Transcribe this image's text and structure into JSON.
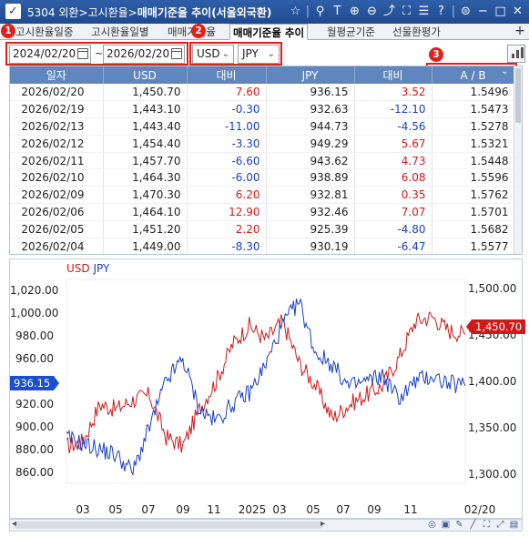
{
  "window": {
    "screen_no": "5304",
    "path": "외환>고시환율>",
    "name": "매매기준율 추이(서울외국환)"
  },
  "tabs": [
    {
      "label": "고시환율일중"
    },
    {
      "label": "고시환율일별"
    },
    {
      "label": "매매기준율"
    },
    {
      "label": "매매기준율 추이"
    },
    {
      "label": "월평균기준"
    },
    {
      "label": "선물환평가"
    }
  ],
  "controls": {
    "start_date": "2024/02/20",
    "range_sep": "~",
    "end_date": "2026/02/20",
    "currency_a": "USD",
    "currency_b": "JPY",
    "badges": [
      "1",
      "2",
      "3"
    ]
  },
  "table": {
    "headers": [
      "일자",
      "USD",
      "대비",
      "JPY",
      "대비",
      "A / B"
    ],
    "rows": [
      {
        "date": "2026/02/20",
        "usd": "1,450.70",
        "usd_chg": "7.60",
        "jpy": "936.15",
        "jpy_chg": "3.52",
        "ab": "1.5496"
      },
      {
        "date": "2026/02/19",
        "usd": "1,443.10",
        "usd_chg": "-0.30",
        "jpy": "932.63",
        "jpy_chg": "-12.10",
        "ab": "1.5473"
      },
      {
        "date": "2026/02/13",
        "usd": "1,443.40",
        "usd_chg": "-11.00",
        "jpy": "944.73",
        "jpy_chg": "-4.56",
        "ab": "1.5278"
      },
      {
        "date": "2026/02/12",
        "usd": "1,454.40",
        "usd_chg": "-3.30",
        "jpy": "949.29",
        "jpy_chg": "5.67",
        "ab": "1.5321"
      },
      {
        "date": "2026/02/11",
        "usd": "1,457.70",
        "usd_chg": "-6.60",
        "jpy": "943.62",
        "jpy_chg": "4.73",
        "ab": "1.5448"
      },
      {
        "date": "2026/02/10",
        "usd": "1,464.30",
        "usd_chg": "-6.00",
        "jpy": "938.89",
        "jpy_chg": "6.08",
        "ab": "1.5596"
      },
      {
        "date": "2026/02/09",
        "usd": "1,470.30",
        "usd_chg": "6.20",
        "jpy": "932.81",
        "jpy_chg": "0.35",
        "ab": "1.5762"
      },
      {
        "date": "2026/02/06",
        "usd": "1,464.10",
        "usd_chg": "12.90",
        "jpy": "932.46",
        "jpy_chg": "7.07",
        "ab": "1.5701"
      },
      {
        "date": "2026/02/05",
        "usd": "1,451.20",
        "usd_chg": "2.20",
        "jpy": "925.39",
        "jpy_chg": "-4.80",
        "ab": "1.5682"
      },
      {
        "date": "2026/02/04",
        "usd": "1,449.00",
        "usd_chg": "-8.30",
        "jpy": "930.19",
        "jpy_chg": "-6.47",
        "ab": "1.5577"
      }
    ]
  },
  "chart": {
    "legend_usd": "USD",
    "legend_jpy": "JPY",
    "usd_last_label": "1,450.70",
    "jpy_last_label": "936.15"
  },
  "chart_data": {
    "type": "line",
    "x_range": [
      "2024/02/20",
      "2026/02/20"
    ],
    "x_ticks": [
      "03",
      "05",
      "07",
      "09",
      "11",
      "2025",
      "03",
      "05",
      "07",
      "09",
      "11",
      "02/20"
    ],
    "left_axis": {
      "series": "JPY",
      "ticks": [
        "1,020.00",
        "1,000.00",
        "980.00",
        "960.00",
        "940.00",
        "920.00",
        "900.00",
        "880.00",
        "860.00"
      ],
      "ylim": [
        850,
        1030
      ]
    },
    "right_axis": {
      "series": "USD",
      "ticks": [
        "1,500.00",
        "1,450.00",
        "1,400.00",
        "1,350.00",
        "1,300.00"
      ],
      "ylim": [
        1290,
        1510
      ]
    },
    "series": [
      {
        "name": "USD",
        "color": "#d01a1a",
        "axis": "right",
        "x": [
          "2024/02",
          "2024/03",
          "2024/04",
          "2024/05",
          "2024/06",
          "2024/07",
          "2024/08",
          "2024/09",
          "2024/10",
          "2024/11",
          "2024/12",
          "2025/01",
          "2025/02",
          "2025/03",
          "2025/04",
          "2025/05",
          "2025/06",
          "2025/07",
          "2025/08",
          "2025/09",
          "2025/10",
          "2025/11",
          "2025/12",
          "2026/01",
          "2026/02"
        ],
        "values": [
          1330,
          1335,
          1375,
          1370,
          1380,
          1385,
          1340,
          1330,
          1370,
          1400,
          1440,
          1460,
          1445,
          1465,
          1420,
          1395,
          1360,
          1375,
          1385,
          1395,
          1425,
          1465,
          1470,
          1455,
          1450.7
        ]
      },
      {
        "name": "JPY",
        "color": "#1a3fc8",
        "axis": "left",
        "x": [
          "2024/02",
          "2024/03",
          "2024/04",
          "2024/05",
          "2024/06",
          "2024/07",
          "2024/08",
          "2024/09",
          "2024/10",
          "2024/11",
          "2024/12",
          "2025/01",
          "2025/02",
          "2025/03",
          "2025/04",
          "2025/05",
          "2025/06",
          "2025/07",
          "2025/08",
          "2025/09",
          "2025/10",
          "2025/11",
          "2025/12",
          "2026/01",
          "2026/02"
        ],
        "values": [
          890,
          885,
          880,
          875,
          860,
          900,
          940,
          960,
          915,
          905,
          920,
          930,
          955,
          990,
          1010,
          965,
          955,
          935,
          940,
          945,
          925,
          940,
          945,
          938,
          936.15
        ]
      }
    ]
  }
}
